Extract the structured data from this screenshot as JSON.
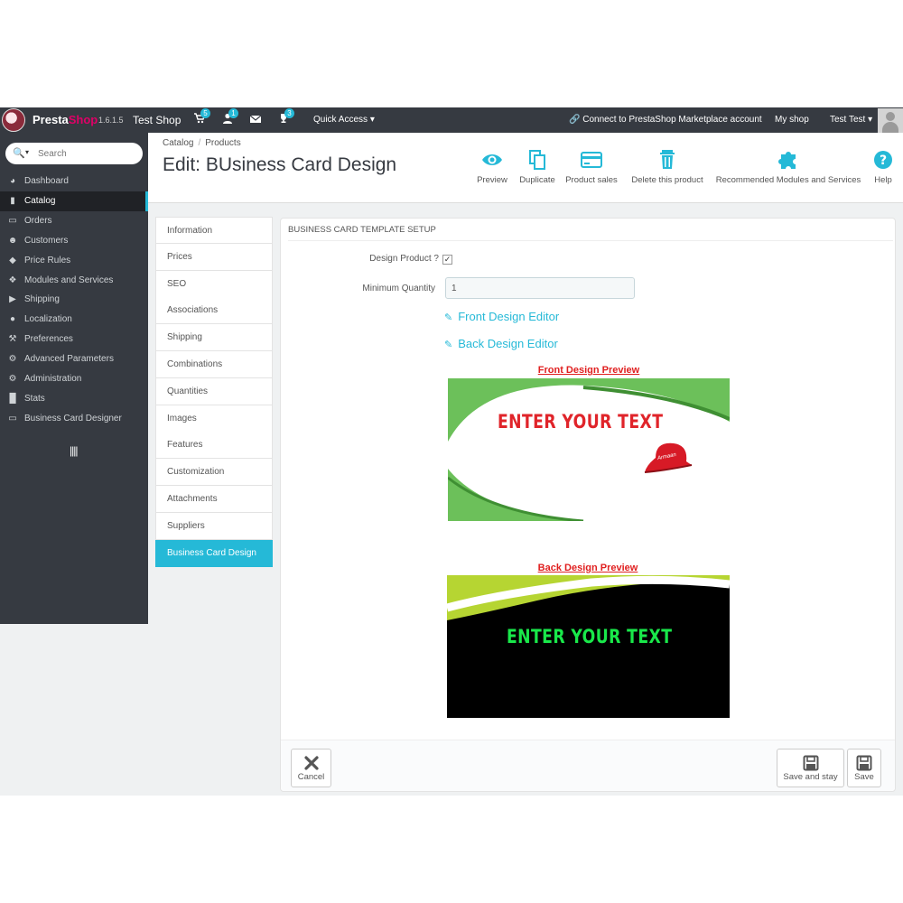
{
  "topbar": {
    "brand_a": "Presta",
    "brand_b": "Shop",
    "version": "1.6.1.5",
    "shop_name": "Test Shop",
    "badges": {
      "orders": "5",
      "customers": "1",
      "messages": "",
      "trophy": "3"
    },
    "quick_access": "Quick Access",
    "connect": "Connect to PrestaShop Marketplace account",
    "my_shop": "My shop",
    "user": "Test Test"
  },
  "sidebar": {
    "search_placeholder": "Search",
    "items": [
      {
        "label": "Dashboard",
        "icon": "dashboard-icon"
      },
      {
        "label": "Catalog",
        "icon": "book-icon"
      },
      {
        "label": "Orders",
        "icon": "credit-card-icon"
      },
      {
        "label": "Customers",
        "icon": "users-icon"
      },
      {
        "label": "Price Rules",
        "icon": "tags-icon"
      },
      {
        "label": "Modules and Services",
        "icon": "puzzle-icon"
      },
      {
        "label": "Shipping",
        "icon": "truck-icon"
      },
      {
        "label": "Localization",
        "icon": "globe-icon"
      },
      {
        "label": "Preferences",
        "icon": "wrench-icon"
      },
      {
        "label": "Advanced Parameters",
        "icon": "cogs-icon"
      },
      {
        "label": "Administration",
        "icon": "cog-icon"
      },
      {
        "label": "Stats",
        "icon": "bar-chart-icon"
      },
      {
        "label": "Business Card Designer",
        "icon": "card-icon"
      }
    ],
    "active_index": 1
  },
  "header": {
    "breadcrumb": [
      "Catalog",
      "Products"
    ],
    "title": "Edit: BUsiness Card Design",
    "toolbar": [
      {
        "label": "Preview",
        "icon": "eye-icon"
      },
      {
        "label": "Duplicate",
        "icon": "copy-icon"
      },
      {
        "label": "Product sales",
        "icon": "credit-card-icon"
      },
      {
        "label": "Delete this product",
        "icon": "trash-icon"
      },
      {
        "label": "Recommended Modules and Services",
        "icon": "puzzle-icon"
      },
      {
        "label": "Help",
        "icon": "help-icon"
      }
    ]
  },
  "tabs": {
    "items": [
      "Information",
      "Prices",
      "SEO",
      "Associations",
      "Shipping",
      "Combinations",
      "Quantities",
      "Images",
      "Features",
      "Customization",
      "Attachments",
      "Suppliers",
      "Business Card Design"
    ],
    "active_index": 12
  },
  "panel": {
    "heading": "Business Card Template Setup",
    "design_product_label": "Design Product ?",
    "design_product_checked": true,
    "min_qty_label": "Minimum Quantity",
    "min_qty_value": "1",
    "front_editor_link": "Front Design Editor",
    "back_editor_link": "Back Design Editor",
    "front_preview_title": "Front Design Preview",
    "back_preview_title": "Back Design Preview",
    "front_card_text": "ENTER YOUR TEXT",
    "front_cap_text": "Armaan",
    "back_card_text": "ENTER YOUR TEXT"
  },
  "footer": {
    "cancel": "Cancel",
    "save_and_stay": "Save and stay",
    "save": "Save"
  },
  "colors": {
    "accent": "#25b9d7",
    "sidebar": "#363a41",
    "front_text": "#e0242a",
    "back_text": "#19e84a",
    "card_green": "#6cc05a"
  }
}
